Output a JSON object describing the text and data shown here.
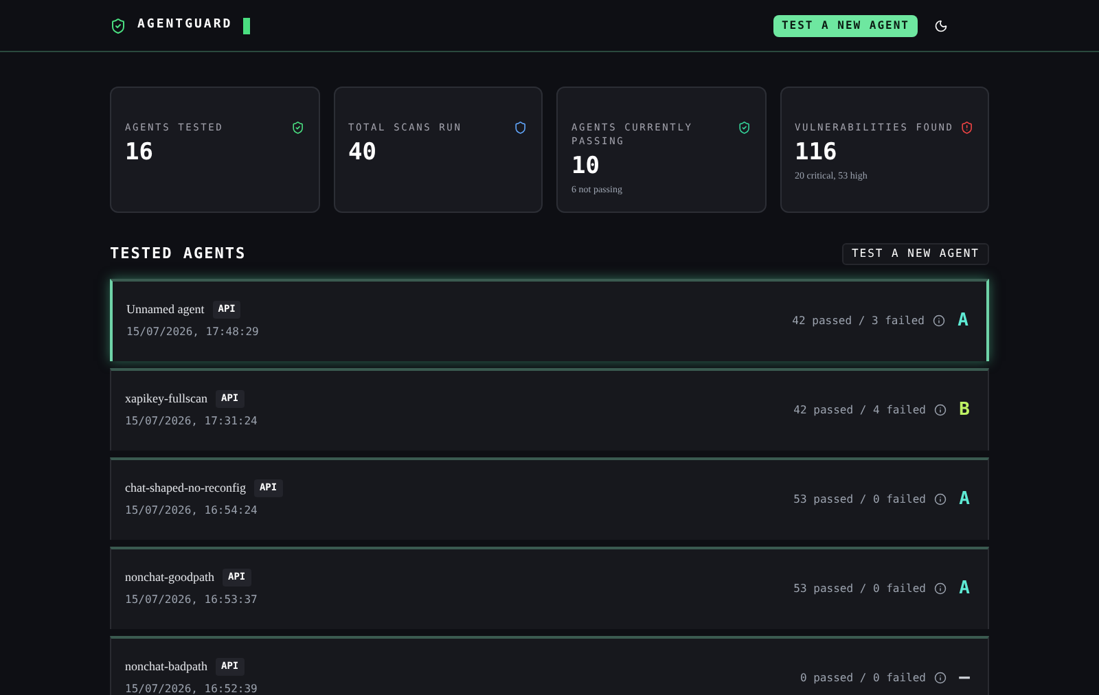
{
  "header": {
    "brand": "AGENTGUARD",
    "cta": "TEST A NEW AGENT"
  },
  "stats": [
    {
      "label": "AGENTS TESTED",
      "value": "16",
      "kind": "check",
      "color": "#4ade80"
    },
    {
      "label": "TOTAL SCANS RUN",
      "value": "40",
      "kind": "plain",
      "color": "#60a5fa"
    },
    {
      "label": "AGENTS CURRENTLY PASSING",
      "value": "10",
      "sub": "6 not passing",
      "kind": "check",
      "color": "#34d399"
    },
    {
      "label": "VULNERABILITIES FOUND",
      "value": "116",
      "sub": "20 critical, 53 high",
      "kind": "alert",
      "color": "#ef4444"
    }
  ],
  "section": {
    "title": "TESTED AGENTS",
    "action": "TEST A NEW AGENT"
  },
  "agents": [
    {
      "name": "Unnamed agent",
      "tag": "API",
      "time": "15/07/2026, 17:48:29",
      "result": "42 passed / 3 failed",
      "grade": "A",
      "color": "#5eead4",
      "selected": true
    },
    {
      "name": "xapikey-fullscan",
      "tag": "API",
      "time": "15/07/2026, 17:31:24",
      "result": "42 passed / 4 failed",
      "grade": "B",
      "color": "#bef264",
      "selected": false
    },
    {
      "name": "chat-shaped-no-reconfig",
      "tag": "API",
      "time": "15/07/2026, 16:54:24",
      "result": "53 passed / 0 failed",
      "grade": "A",
      "color": "#5eead4",
      "selected": false
    },
    {
      "name": "nonchat-goodpath",
      "tag": "API",
      "time": "15/07/2026, 16:53:37",
      "result": "53 passed / 0 failed",
      "grade": "A",
      "color": "#5eead4",
      "selected": false
    },
    {
      "name": "nonchat-badpath",
      "tag": "API",
      "time": "15/07/2026, 16:52:39",
      "result": "0 passed / 0 failed",
      "grade": "—",
      "color": "#d1d5db",
      "selected": false
    }
  ]
}
